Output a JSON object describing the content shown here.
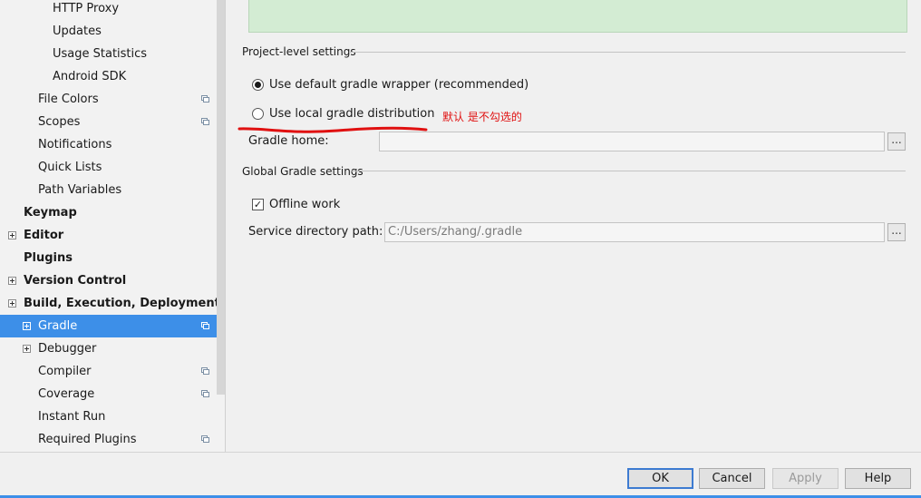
{
  "sidebar": {
    "items": [
      {
        "label": "HTTP Proxy",
        "bold": false,
        "expander": false,
        "icon": false,
        "selected": false
      },
      {
        "label": "Updates",
        "bold": false,
        "expander": false,
        "icon": false,
        "selected": false
      },
      {
        "label": "Usage Statistics",
        "bold": false,
        "expander": false,
        "icon": false,
        "selected": false
      },
      {
        "label": "Android SDK",
        "bold": false,
        "expander": false,
        "icon": false,
        "selected": false
      },
      {
        "label": "File Colors",
        "bold": false,
        "expander": false,
        "icon": true,
        "selected": false
      },
      {
        "label": "Scopes",
        "bold": false,
        "expander": false,
        "icon": true,
        "selected": false
      },
      {
        "label": "Notifications",
        "bold": false,
        "expander": false,
        "icon": false,
        "selected": false
      },
      {
        "label": "Quick Lists",
        "bold": false,
        "expander": false,
        "icon": false,
        "selected": false
      },
      {
        "label": "Path Variables",
        "bold": false,
        "expander": false,
        "icon": false,
        "selected": false
      },
      {
        "label": "Keymap",
        "bold": true,
        "expander": false,
        "icon": false,
        "selected": false
      },
      {
        "label": "Editor",
        "bold": true,
        "expander": true,
        "icon": false,
        "selected": false
      },
      {
        "label": "Plugins",
        "bold": true,
        "expander": false,
        "icon": false,
        "selected": false
      },
      {
        "label": "Version Control",
        "bold": true,
        "expander": true,
        "icon": false,
        "selected": false
      },
      {
        "label": "Build, Execution, Deployment",
        "bold": true,
        "expander": true,
        "icon": false,
        "selected": false
      },
      {
        "label": "Gradle",
        "bold": false,
        "expander": true,
        "icon": true,
        "selected": true
      },
      {
        "label": "Debugger",
        "bold": false,
        "expander": true,
        "icon": false,
        "selected": false
      },
      {
        "label": "Compiler",
        "bold": false,
        "expander": false,
        "icon": true,
        "selected": false
      },
      {
        "label": "Coverage",
        "bold": false,
        "expander": false,
        "icon": true,
        "selected": false
      },
      {
        "label": "Instant Run",
        "bold": false,
        "expander": false,
        "icon": false,
        "selected": false
      },
      {
        "label": "Required Plugins",
        "bold": false,
        "expander": false,
        "icon": true,
        "selected": false
      }
    ]
  },
  "project_settings": {
    "title": "Project-level settings",
    "option_default_wrapper": "Use default gradle wrapper (recommended)",
    "option_local_distribution": "Use local gradle distribution",
    "annotation": "默认 是不勾选的",
    "gradle_home_label": "Gradle home:",
    "gradle_home_value": "",
    "browse_label": "..."
  },
  "global_settings": {
    "title": "Global Gradle settings",
    "offline_work_label": "Offline work",
    "offline_work_checked": true,
    "service_dir_label": "Service directory path:",
    "service_dir_value": "C:/Users/zhang/.gradle",
    "browse_label": "..."
  },
  "footer": {
    "ok": "OK",
    "cancel": "Cancel",
    "apply": "Apply",
    "help": "Help"
  },
  "colors": {
    "selection": "#3d8fe8",
    "annotation": "#e01010",
    "info_panel": "#d3ecd3"
  }
}
